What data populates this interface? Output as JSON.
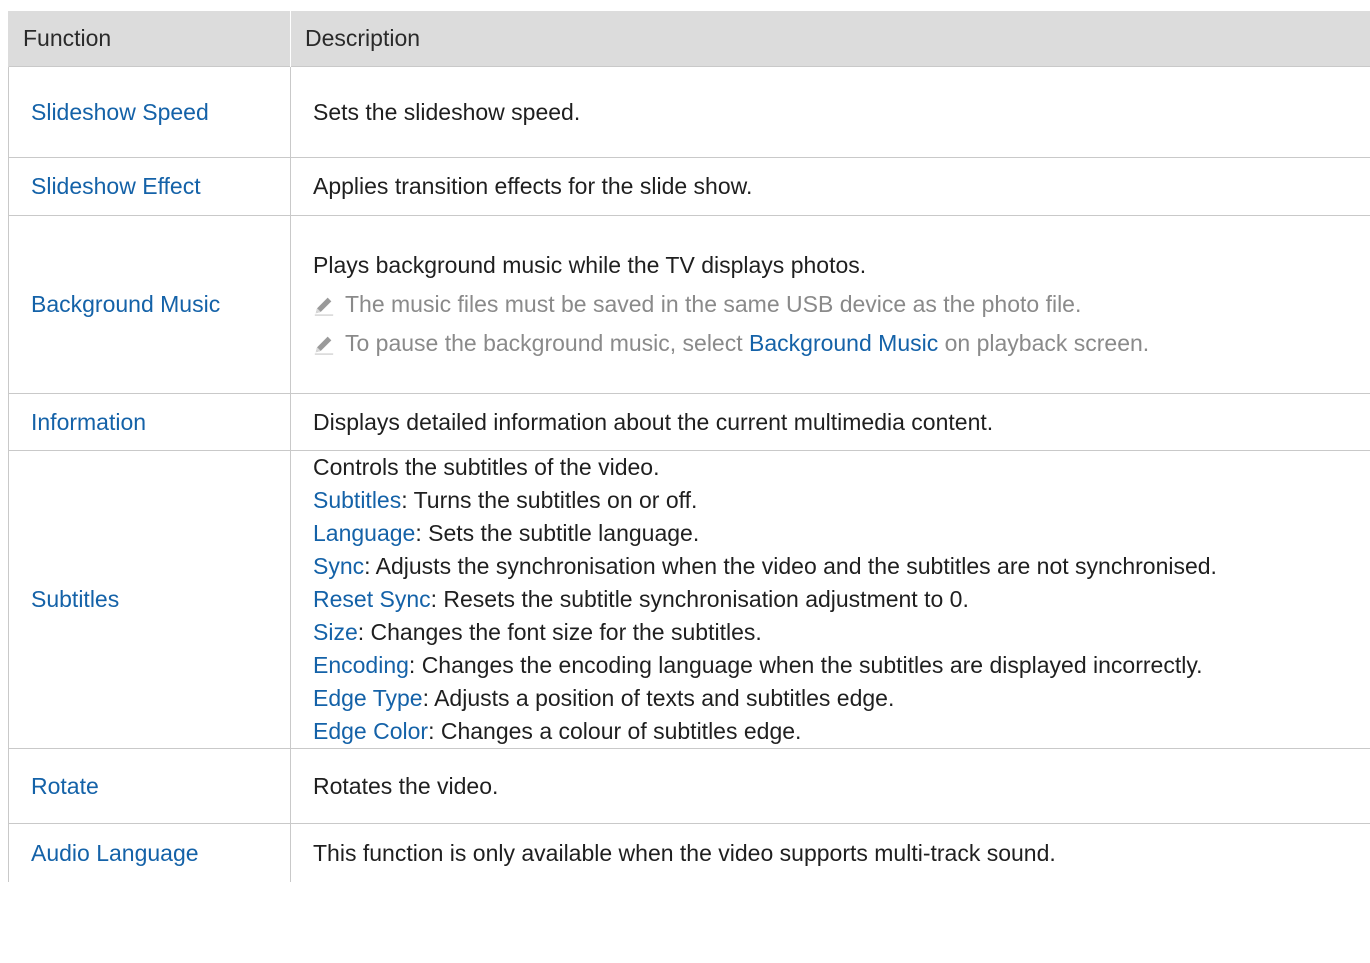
{
  "header": {
    "function": "Function",
    "description": "Description"
  },
  "rows": [
    {
      "function": "Slideshow Speed",
      "description": "Sets the slideshow speed."
    },
    {
      "function": "Slideshow Effect",
      "description": "Applies transition effects for the slide show."
    },
    {
      "function": "Background Music",
      "description": "Plays background music while the TV displays photos.",
      "note1": "The music files must be saved in the same USB device as the photo file.",
      "note2_pre": "To pause the background music, select ",
      "note2_hl": "Background Music",
      "note2_post": " on playback screen."
    },
    {
      "function": "Information",
      "description": "Displays detailed information about the current multimedia content."
    },
    {
      "function": "Subtitles",
      "description": "Controls the subtitles of the video.",
      "items": [
        {
          "name": "Subtitles",
          "text": ": Turns the subtitles on or off."
        },
        {
          "name": "Language",
          "text": ": Sets the subtitle language."
        },
        {
          "name": "Sync",
          "text": ": Adjusts the synchronisation when the video and the subtitles are not synchronised."
        },
        {
          "name": "Reset Sync",
          "text": ": Resets the subtitle synchronisation adjustment to 0."
        },
        {
          "name": "Size",
          "text": ": Changes the font size for the subtitles."
        },
        {
          "name": "Encoding",
          "text": ": Changes the encoding language when the subtitles are displayed incorrectly."
        },
        {
          "name": "Edge Type",
          "text": ": Adjusts a position of texts and subtitles edge."
        },
        {
          "name": "Edge Color",
          "text": ": Changes a colour of subtitles edge."
        }
      ]
    },
    {
      "function": "Rotate",
      "description": "Rotates the video."
    },
    {
      "function": "Audio Language",
      "description": "This function is only available when the video supports multi-track sound."
    }
  ],
  "colors": {
    "link": "#1462a8",
    "header_bg": "#dcdcdc",
    "note_text": "#8a8a8a",
    "border": "#c9c9c9"
  },
  "icons": {
    "note": "pencil-icon"
  }
}
